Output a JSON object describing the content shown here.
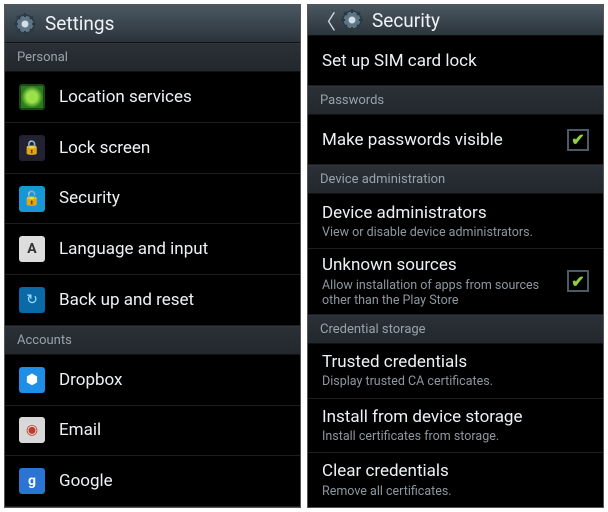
{
  "left": {
    "title": "Settings",
    "sections": [
      {
        "header": "Personal",
        "items": [
          {
            "icon": "location",
            "label": "Location services"
          },
          {
            "icon": "lock",
            "label": "Lock screen"
          },
          {
            "icon": "security",
            "label": "Security"
          },
          {
            "icon": "lang",
            "label": "Language and input"
          },
          {
            "icon": "backup",
            "label": "Back up and reset"
          }
        ]
      },
      {
        "header": "Accounts",
        "items": [
          {
            "icon": "dropbox",
            "label": "Dropbox"
          },
          {
            "icon": "email",
            "label": "Email"
          },
          {
            "icon": "google",
            "label": "Google"
          }
        ]
      }
    ]
  },
  "right": {
    "title": "Security",
    "top_item": {
      "label": "Set up SIM card lock"
    },
    "sections": [
      {
        "header": "Passwords",
        "items": [
          {
            "label": "Make passwords visible",
            "checked": true
          }
        ]
      },
      {
        "header": "Device administration",
        "items": [
          {
            "label": "Device administrators",
            "sub": "View or disable device administrators."
          },
          {
            "label": "Unknown sources",
            "sub": "Allow installation of apps from sources other than the Play Store",
            "checked": true
          }
        ]
      },
      {
        "header": "Credential storage",
        "items": [
          {
            "label": "Trusted credentials",
            "sub": "Display trusted CA certificates."
          },
          {
            "label": "Install from device storage",
            "sub": "Install certificates from storage."
          },
          {
            "label": "Clear credentials",
            "sub": "Remove all certificates."
          }
        ]
      }
    ]
  },
  "icon_glyphs": {
    "location": "",
    "lock": "🔒",
    "security": "🔓",
    "lang": "A",
    "backup": "↻",
    "dropbox": "⬢",
    "email": "◉",
    "google": "g"
  }
}
